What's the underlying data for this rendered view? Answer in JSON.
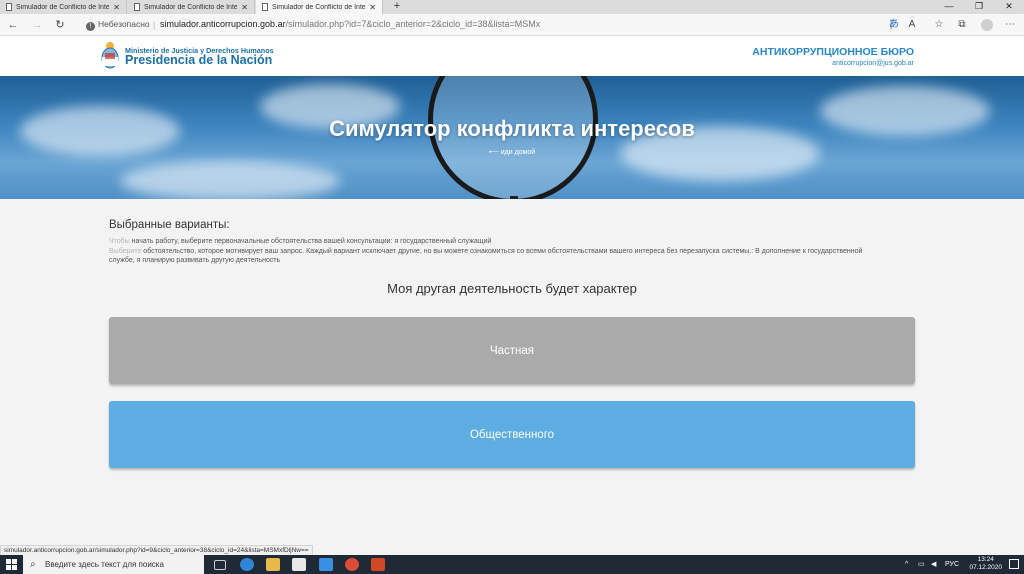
{
  "browser": {
    "tabs": [
      {
        "label": "Simulador de Conflicto de Intere"
      },
      {
        "label": "Simulador de Conflicto de Intere"
      },
      {
        "label": "Simulador de Conflicto de Intere"
      }
    ],
    "new_tab_icon": "plus-icon",
    "security_label": "Небезопасно",
    "url_domain": "simulador.anticorrupcion.gob.ar",
    "url_path": "/simulador.php?id=7&ciclo_anterior=2&ciclo_id=38&lista=MSMx",
    "status_url": "simulador.anticorrupcion.gob.ar/simulador.php?id=9&ciclo_anterior=38&ciclo_id=24&lista=MSMxfDljNw=="
  },
  "header": {
    "ministry": "Ministerio de Justicia y Derechos Humanos",
    "presidency": "Presidencia de la Nación",
    "bureau_title": "АНТИКОРРУПЦИОННОЕ БЮРО",
    "bureau_email": "anticorrupcion@jus.gob.ar"
  },
  "hero": {
    "title": "Симулятор конфликта интересов",
    "back_link": "⟵ иди домой"
  },
  "main": {
    "selected_title": "Выбранные варианты:",
    "line1_muted": "Чтобы",
    "line1_text": " начать работу, выберите первоначальные обстоятельства вашей консультации: я государственный служащий",
    "line2_muted": "Выберите",
    "line2_text": " обстоятельство, которое мотивирует ваш запрос. Каждый вариант исключает другие, но вы можете ознакомиться со всеми обстоятельствами вашего интереса без перезапуска системы.: В дополнение к государственной службе, я планирую развивать другую деятельность",
    "question": "Моя другая деятельность будет характер",
    "options": [
      {
        "label": "Частная",
        "color": "#aaaaaa"
      },
      {
        "label": "Общественного",
        "color": "#5dade2"
      }
    ]
  },
  "taskbar": {
    "search_placeholder": "Введите здесь текст для поиска",
    "lang": "РУС",
    "time": "13:24",
    "date": "07.12.2020"
  }
}
